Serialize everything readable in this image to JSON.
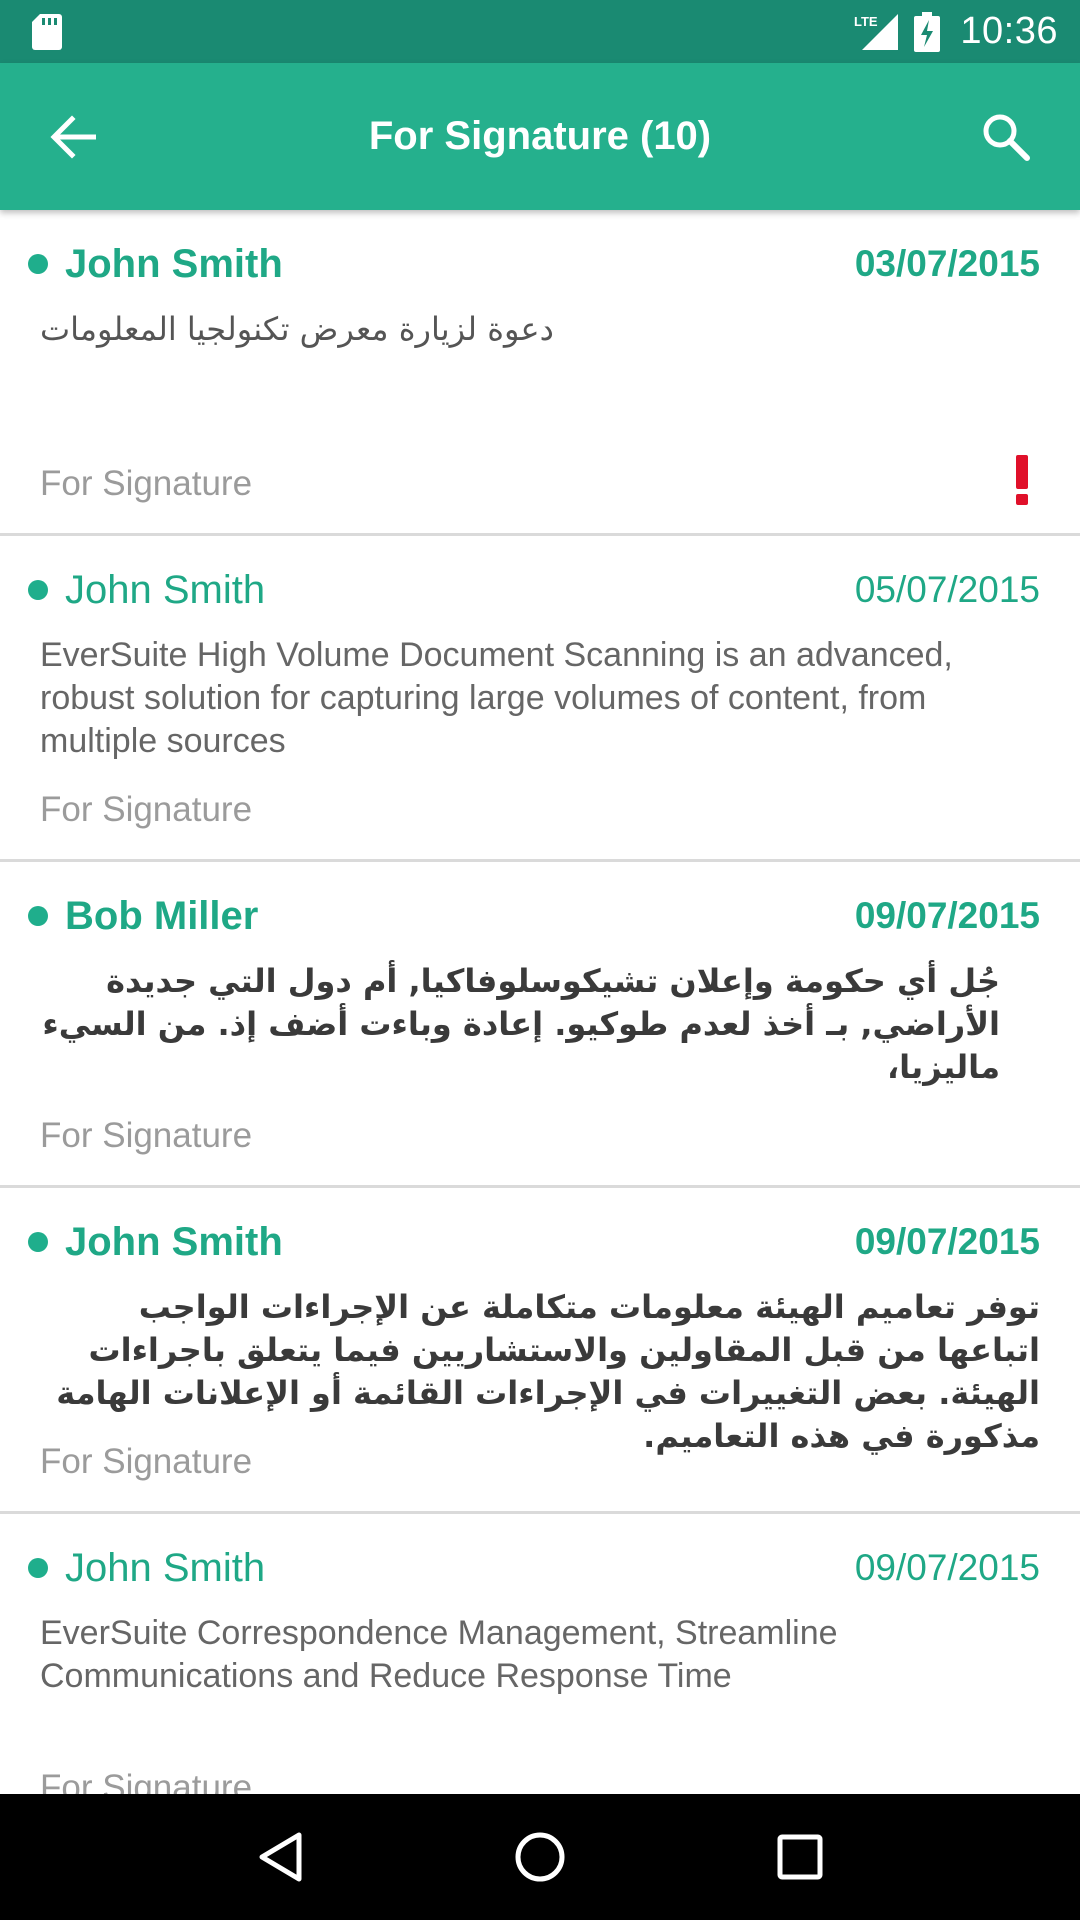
{
  "status_bar": {
    "time": "10:36",
    "network": "LTE",
    "sd_icon": "sd-card-icon",
    "battery_icon": "battery-charging-icon"
  },
  "app_bar": {
    "title": "For Signature (10)",
    "back_icon": "arrow-back-icon",
    "search_icon": "search-icon"
  },
  "colors": {
    "status_bar": "#1a8a72",
    "app_bar": "#25b08d",
    "accent": "#1fa886",
    "priority": "#e0102a"
  },
  "items": [
    {
      "sender": "John Smith",
      "date": "03/07/2015",
      "body": "دعوة لزيارة معرض تكنولجيا المعلومات",
      "status": "For Signature",
      "unread": true,
      "high_priority": true
    },
    {
      "sender": "John Smith",
      "date": "05/07/2015",
      "body": "EverSuite High Volume Document Scanning is an advanced, robust solution for capturing large volumes of content, from multiple sources",
      "status": "For Signature",
      "unread": false,
      "high_priority": false
    },
    {
      "sender": "Bob Miller",
      "date": "09/07/2015",
      "body": "جُل أي حكومة وإعلان تشيكوسلوفاكيا, أم دول التي جديدة الأراضي, بـ أخذ لعدم طوكيو. إعادة وباءت أضف إذ. من السيء ماليزيا،",
      "status": "For Signature",
      "unread": true,
      "high_priority": false
    },
    {
      "sender": "John Smith",
      "date": "09/07/2015",
      "body": "توفر تعاميم الهيئة معلومات متكاملة عن الإجراءات الواجب اتباعها من قبل المقاولين والاستشاريين فيما يتعلق باجراءات الهيئة. بعض التغييرات في الإجراءات القائمة أو الإعلانات الهامة مذكورة في هذه التعاميم.",
      "status": "For Signature",
      "unread": true,
      "high_priority": false
    },
    {
      "sender": "John Smith",
      "date": "09/07/2015",
      "body": "EverSuite Correspondence Management, Streamline Communications and Reduce Response Time",
      "status": "For Signature",
      "unread": false,
      "high_priority": false
    }
  ],
  "nav_bar": {
    "back_icon": "nav-back-icon",
    "home_icon": "nav-home-icon",
    "recents_icon": "nav-recents-icon"
  }
}
